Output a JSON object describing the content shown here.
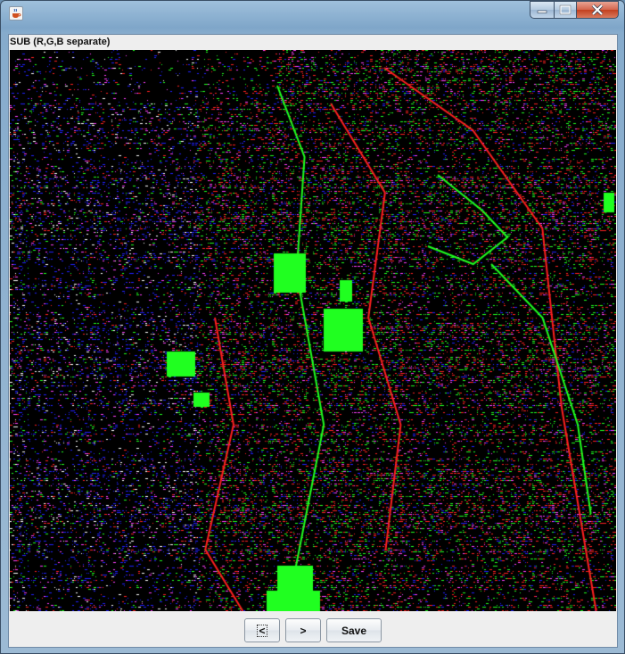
{
  "window": {
    "app_icon": "java-cup-icon",
    "controls": {
      "minimize": "minimize-icon",
      "maximize": "maximize-icon",
      "close": "close-icon"
    }
  },
  "panel": {
    "label": "SUB (R,G,B separate)"
  },
  "image": {
    "description_icon": "edge-detection-image",
    "colors": {
      "background": "#000000",
      "red": "#ff2020",
      "green": "#20ff20",
      "blue": "#2020ff",
      "magenta": "#ff40ff"
    }
  },
  "buttons": {
    "prev": "<",
    "next": ">",
    "save": "Save"
  }
}
